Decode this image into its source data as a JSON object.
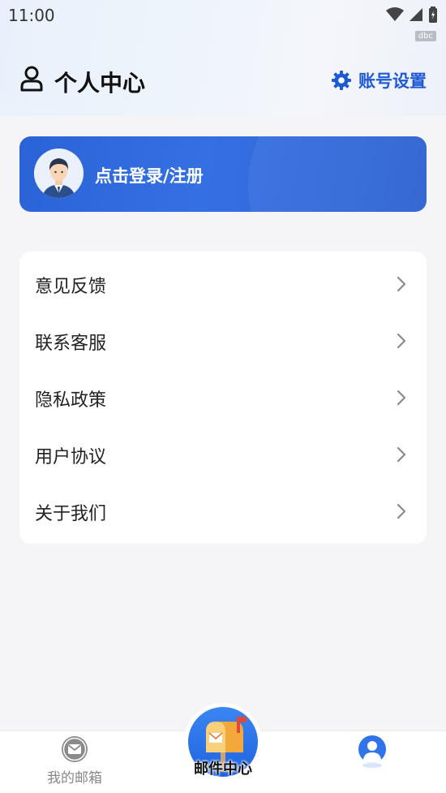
{
  "status_bar": {
    "time": "11:00",
    "badge": "dbc"
  },
  "header": {
    "title": "个人中心",
    "settings_label": "账号设置"
  },
  "login": {
    "label": "点击登录/注册"
  },
  "menu": {
    "items": [
      {
        "label": "意见反馈"
      },
      {
        "label": "联系客服"
      },
      {
        "label": "隐私政策"
      },
      {
        "label": "用户协议"
      },
      {
        "label": "关于我们"
      }
    ]
  },
  "tab_bar": {
    "mailbox_label": "我的邮箱",
    "center_label": "邮件中心"
  },
  "colors": {
    "accent": "#1e5ad6",
    "card": "#2f6ade",
    "background": "#f5f5f7"
  }
}
